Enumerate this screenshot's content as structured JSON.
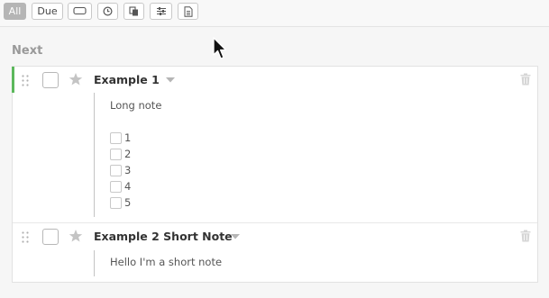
{
  "toolbar": {
    "all_label": "All",
    "due_label": "Due",
    "icon_buttons": [
      "label-icon",
      "clock-icon",
      "copy-icon",
      "sliders-icon",
      "document-icon"
    ]
  },
  "section_title": "Next",
  "tasks": [
    {
      "title": "Example 1",
      "note": "Long note",
      "checklist": [
        "1",
        "2",
        "3",
        "4",
        "5"
      ],
      "accent_color": "#5cb85c"
    },
    {
      "title": "Example 2 Short Note",
      "note": "Hello I'm a short note"
    }
  ]
}
